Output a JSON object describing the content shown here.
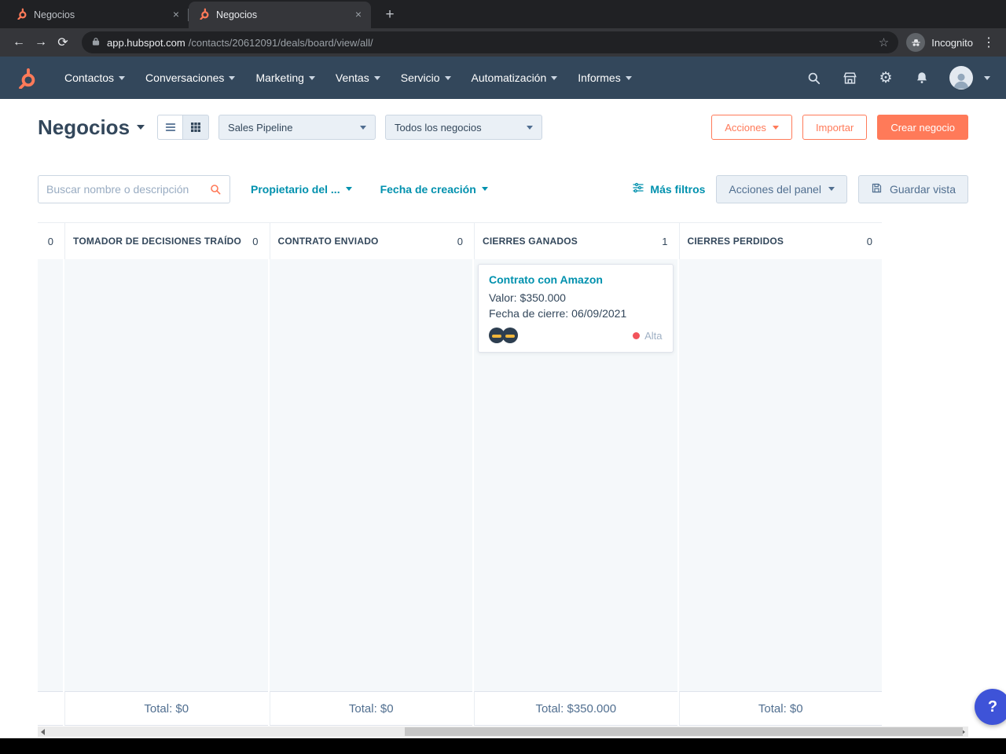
{
  "colors": {
    "accent_orange": "#ff7a59",
    "navy": "#33475b",
    "link_teal": "#0091ae",
    "board_bg": "#f5f8fa",
    "priority_red": "#f2545b",
    "help_blue": "#3e53d8"
  },
  "browser": {
    "tabs": [
      {
        "title": "Negocios"
      },
      {
        "title": "Negocios"
      }
    ],
    "url_domain": "app.hubspot.com",
    "url_path": "/contacts/20612091/deals/board/view/all/",
    "incognito_label": "Incognito"
  },
  "icons": {
    "back": "←",
    "forward": "→",
    "reload": "⟳",
    "star": "☆",
    "menu": "⋮",
    "close": "×",
    "new_tab": "+",
    "gear": "⚙"
  },
  "topnav": {
    "items": [
      "Contactos",
      "Conversaciones",
      "Marketing",
      "Ventas",
      "Servicio",
      "Automatización",
      "Informes"
    ]
  },
  "header": {
    "title": "Negocios",
    "pipeline_select": "Sales Pipeline",
    "view_select": "Todos los negocios",
    "actions_button": "Acciones",
    "import_button": "Importar",
    "create_button": "Crear negocio"
  },
  "filters": {
    "search_placeholder": "Buscar nombre o descripción",
    "owner_filter": "Propietario del ...",
    "date_filter": "Fecha de creación",
    "more_filters": "Más filtros",
    "board_actions": "Acciones del panel",
    "save_view": "Guardar vista"
  },
  "board": {
    "leading_count": "0",
    "columns": [
      {
        "name": "TOMADOR DE DECISIONES TRAÍDO",
        "count": "0",
        "total": "Total: $0"
      },
      {
        "name": "CONTRATO ENVIADO",
        "count": "0",
        "total": "Total: $0"
      },
      {
        "name": "CIERRES GANADOS",
        "count": "1",
        "total": "Total: $350.000",
        "card": {
          "title": "Contrato con Amazon",
          "value_label": "Valor:",
          "value": "$350.000",
          "close_label": "Fecha de cierre:",
          "close_date": "06/09/2021",
          "priority": "Alta"
        }
      },
      {
        "name": "CIERRES PERDIDOS",
        "count": "0",
        "total": "Total: $0"
      }
    ]
  },
  "help": {
    "label": "?"
  }
}
